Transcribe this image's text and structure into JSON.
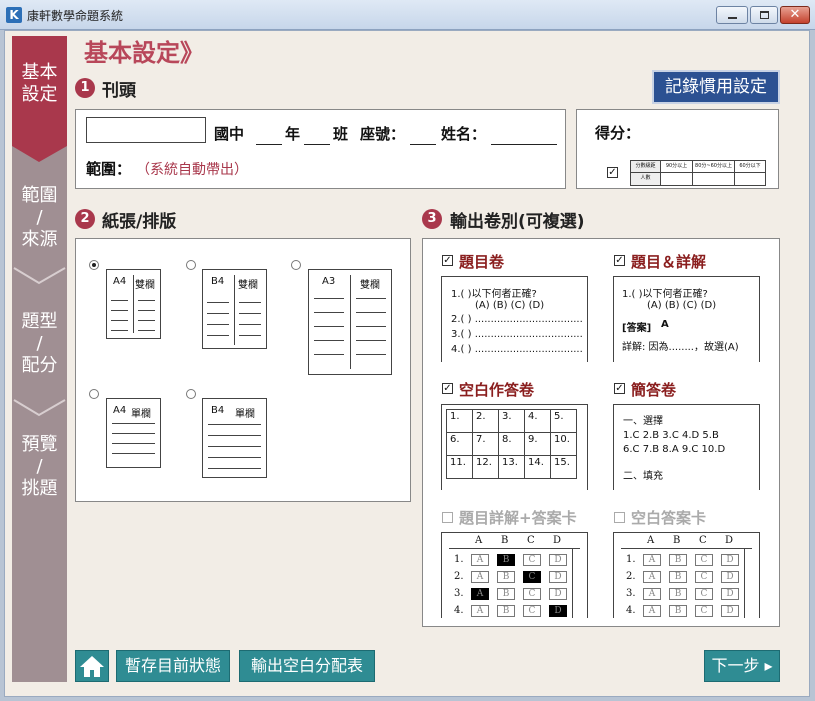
{
  "window": {
    "title": "康軒數學命題系統",
    "app_icon": "K"
  },
  "sidebar": {
    "tabs": [
      {
        "label": "基本\n設定",
        "active": true
      },
      {
        "label": "範圍\n/\n來源"
      },
      {
        "label": "題型\n/\n配分"
      },
      {
        "label": "預覽\n/\n挑題"
      }
    ]
  },
  "heading": "基本設定》",
  "save_pref_button": "記錄慣用設定",
  "sec1": {
    "num": "1",
    "title": "刊頭",
    "header_fields": {
      "school": "國中",
      "grade": "年",
      "class": "班",
      "seat": "座號：",
      "name": "姓名：",
      "range_label": "範圍：",
      "range_value": "（系統自動帶出）"
    },
    "score": {
      "label": "得分：",
      "checked": true,
      "table_headers": [
        "分數級距",
        "90分以上",
        "80分~60分以上",
        "60分以下"
      ],
      "table_row": "人數"
    }
  },
  "sec2": {
    "num": "2",
    "title": "紙張/排版",
    "papers": [
      {
        "size": "A4",
        "cols": "雙欄",
        "selected": true
      },
      {
        "size": "B4",
        "cols": "雙欄",
        "selected": false
      },
      {
        "size": "A3",
        "cols": "雙欄",
        "selected": false
      },
      {
        "size": "A4",
        "cols": "單欄",
        "selected": false
      },
      {
        "size": "B4",
        "cols": "單欄",
        "selected": false
      }
    ]
  },
  "sec3": {
    "num": "3",
    "title": "輸出卷別(可複選)",
    "options": [
      {
        "title": "題目卷",
        "checked": true,
        "enabled": true
      },
      {
        "title": "題目＆詳解",
        "checked": true,
        "enabled": true
      },
      {
        "title": "空白作答卷",
        "checked": true,
        "enabled": true
      },
      {
        "title": "簡答卷",
        "checked": true,
        "enabled": true
      },
      {
        "title": "題目詳解+答案卡",
        "checked": false,
        "enabled": false
      },
      {
        "title": "空白答案卡",
        "checked": false,
        "enabled": false
      }
    ],
    "preview_question": {
      "q": "1.( )以下何者正確?",
      "choices": "(A)  (B)  (C)  (D)",
      "lines": [
        "2.( ) ..................................",
        "3.( ) ..................................",
        "4.( ) .................................."
      ]
    },
    "preview_answer": {
      "q": "1.( )以下何者正確?",
      "choices": "(A)  (B)  (C)  (D)",
      "answer_label": "[答案]",
      "answer": "A",
      "explain": "詳解: 因為........，故選(A)"
    },
    "preview_grid": [
      "1.",
      "2.",
      "3.",
      "4.",
      "5.",
      "6.",
      "7.",
      "8.",
      "9.",
      "10.",
      "11.",
      "12.",
      "13.",
      "14.",
      "15."
    ],
    "preview_brief": {
      "sec1": "一、選擇",
      "row1": "1.C  2.B  3.C  4.D  5.B",
      "row2": "6.C  7.B  8.A  9.C  10.D",
      "sec2": "二、填充"
    },
    "card_headers": [
      "A",
      "B",
      "C",
      "D"
    ],
    "card_rows": [
      "1.",
      "2.",
      "3.",
      "4."
    ],
    "card_fills": [
      1,
      2,
      0,
      3
    ]
  },
  "bottom": {
    "save_state": "暫存目前狀態",
    "export_blank": "輸出空白分配表",
    "next": "下一步 ▸"
  },
  "colors": {
    "accent": "#a9384c",
    "teal": "#2f8c93",
    "navy": "#2c5192"
  }
}
